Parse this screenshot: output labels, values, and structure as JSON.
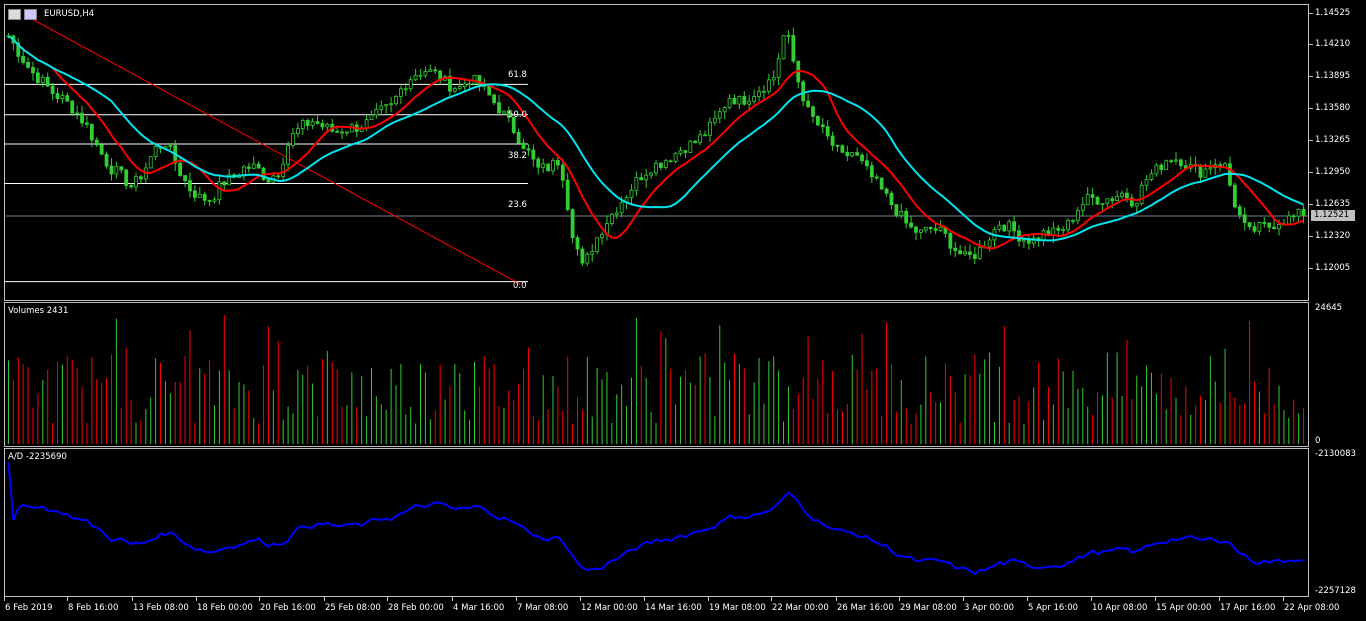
{
  "symbol": {
    "title": "EURUSD,H4"
  },
  "price_panel": {
    "y_labels": [
      "1.14525",
      "1.14210",
      "1.13895",
      "1.13580",
      "1.13265",
      "1.12950",
      "1.12635",
      "1.12320",
      "1.12005"
    ],
    "current_price": "1.12521",
    "fibonacci_levels": [
      "61.8",
      "50.0",
      "38.2",
      "23.6",
      "0.0"
    ]
  },
  "volume_panel": {
    "label": "Volumes 2431",
    "y_max": "24645",
    "y_min": "0"
  },
  "ad_panel": {
    "label": "A/D -2235690",
    "y_max": "-2130083",
    "y_min": "-2257128"
  },
  "time_axis": [
    "6 Feb 2019",
    "8 Feb 16:00",
    "13 Feb 08:00",
    "18 Feb 00:00",
    "20 Feb 16:00",
    "25 Feb 08:00",
    "28 Feb 00:00",
    "4 Mar 16:00",
    "7 Mar 08:00",
    "12 Mar 00:00",
    "14 Mar 16:00",
    "19 Mar 08:00",
    "22 Mar 00:00",
    "26 Mar 16:00",
    "29 Mar 08:00",
    "3 Apr 00:00",
    "5 Apr 16:00",
    "10 Apr 08:00",
    "15 Apr 00:00",
    "17 Apr 16:00",
    "22 Apr 08:00"
  ],
  "colors": {
    "bull": "#32cd32",
    "bear": "#ff0000",
    "ma_fast": "#ff0000",
    "ma_slow": "#00e5ee",
    "ad_line": "#0000ff",
    "grid": "#c0c0c0",
    "trendline": "#ff0000"
  },
  "chart_data": {
    "type": "line",
    "close_path_price": [
      1.143,
      1.1412,
      1.1395,
      1.1385,
      1.1373,
      1.1366,
      1.1355,
      1.134,
      1.1318,
      1.13,
      1.1292,
      1.128,
      1.1296,
      1.1318,
      1.1325,
      1.13,
      1.128,
      1.127,
      1.1268,
      1.1285,
      1.129,
      1.13,
      1.13,
      1.1288,
      1.1296,
      1.1328,
      1.134,
      1.1346,
      1.134,
      1.1335,
      1.1338,
      1.134,
      1.1345,
      1.1355,
      1.136,
      1.138,
      1.1392,
      1.1396,
      1.1392,
      1.1382,
      1.1378,
      1.1388,
      1.138,
      1.1366,
      1.1352,
      1.1335,
      1.1318,
      1.1298,
      1.13,
      1.1308,
      1.124,
      1.12,
      1.1225,
      1.1245,
      1.126,
      1.1275,
      1.129,
      1.13,
      1.1305,
      1.1312,
      1.132,
      1.1325,
      1.1335,
      1.135,
      1.137,
      1.1365,
      1.1372,
      1.138,
      1.139,
      1.1438,
      1.139,
      1.1355,
      1.134,
      1.1325,
      1.131,
      1.1315,
      1.13,
      1.1285,
      1.127,
      1.1255,
      1.124,
      1.1235,
      1.124,
      1.1235,
      1.122,
      1.121,
      1.1215,
      1.123,
      1.1245,
      1.124,
      1.123,
      1.1228,
      1.1235,
      1.1235,
      1.1242,
      1.126,
      1.127,
      1.1268,
      1.127,
      1.1275,
      1.1265,
      1.1288,
      1.1298,
      1.131,
      1.1308,
      1.13,
      1.1295,
      1.1305,
      1.1302,
      1.126,
      1.1235,
      1.124,
      1.1242,
      1.1248,
      1.125,
      1.1255
    ],
    "volumes_max": 24645,
    "ad_range": [
      -2257128,
      -2130083
    ],
    "ad_last": -2235690,
    "fibonacci": [
      "61.8",
      "50.0",
      "38.2",
      "23.6",
      "0.0"
    ]
  }
}
